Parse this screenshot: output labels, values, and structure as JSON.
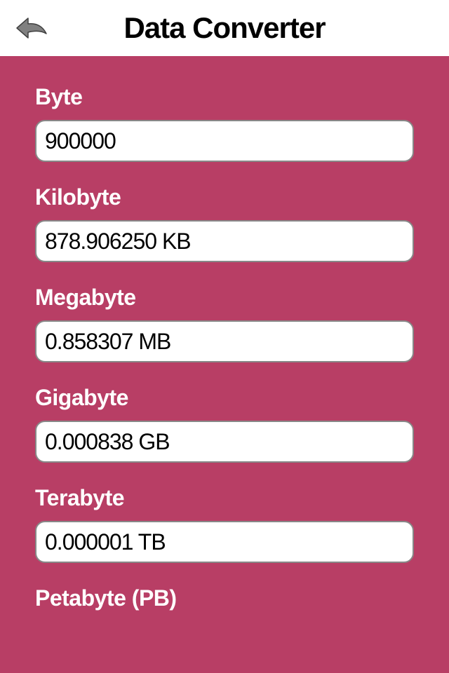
{
  "header": {
    "title": "Data Converter",
    "back_icon": "back-arrow"
  },
  "fields": [
    {
      "label": "Byte",
      "value": "900000"
    },
    {
      "label": "Kilobyte",
      "value": "878.906250 KB"
    },
    {
      "label": "Megabyte",
      "value": "0.858307 MB"
    },
    {
      "label": "Gigabyte",
      "value": "0.000838 GB"
    },
    {
      "label": "Terabyte",
      "value": "0.000001 TB"
    },
    {
      "label": "Petabyte (PB)",
      "value": ""
    }
  ],
  "colors": {
    "accent": "#b83e65",
    "header_bg": "#ffffff",
    "text_primary": "#000000",
    "label": "#ffffff"
  }
}
